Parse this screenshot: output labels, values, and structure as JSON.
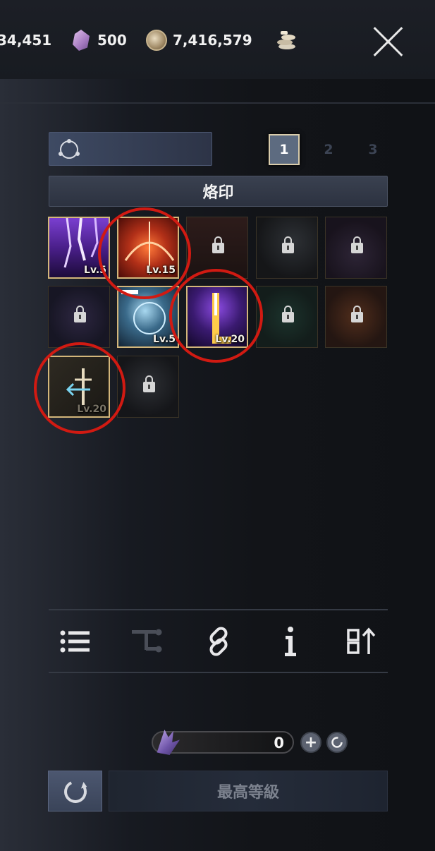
{
  "currencies": {
    "first_value": "34,451",
    "gem_value": "500",
    "coin_value": "7,416,579"
  },
  "pages": [
    "1",
    "2",
    "3"
  ],
  "active_page": "1",
  "section_title": "烙印",
  "skills": [
    {
      "state": "unlocked",
      "level": "Lv.5"
    },
    {
      "state": "unlocked",
      "level": "Lv.15"
    },
    {
      "state": "locked"
    },
    {
      "state": "locked"
    },
    {
      "state": "locked"
    },
    {
      "state": "locked"
    },
    {
      "state": "unlocked",
      "level": "Lv.5"
    },
    {
      "state": "unlocked",
      "level": "Lv.20"
    },
    {
      "state": "locked"
    },
    {
      "state": "locked"
    },
    {
      "state": "unlocked",
      "level": "Lv.20"
    },
    {
      "state": "locked"
    }
  ],
  "toolbar": [
    "list-icon",
    "branch-icon",
    "link-icon",
    "info-icon",
    "sort-icon"
  ],
  "stones": {
    "count": "0"
  },
  "max_level_label": "最高等級",
  "colors": {
    "highlight_circle": "#d11a12",
    "active_border": "#d3b67a",
    "active_tab": "#5d6b80"
  }
}
